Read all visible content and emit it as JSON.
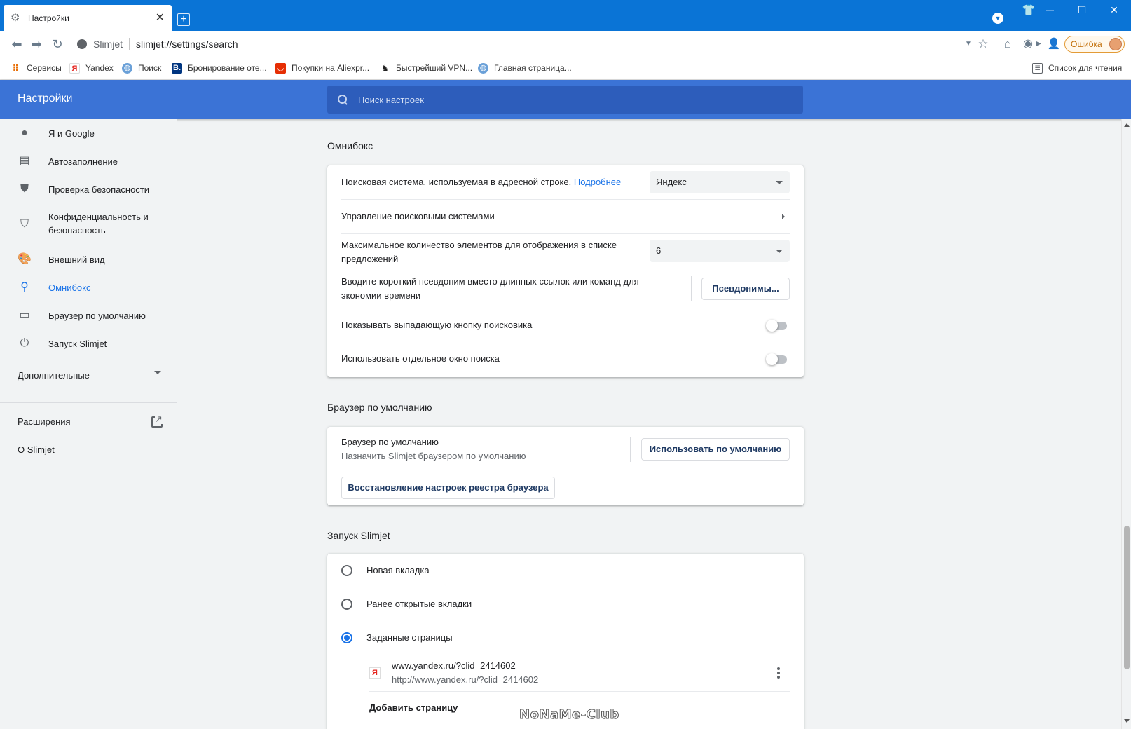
{
  "window": {
    "tab_title": "Настройки",
    "new_tab": "+",
    "controls": {
      "minimize": "—",
      "maximize": "☐",
      "close": "✕"
    }
  },
  "toolbar": {
    "site_name": "Slimjet",
    "url": "slimjet://settings/search",
    "error_label": "Ошибка"
  },
  "bookmarks": [
    {
      "label": "Сервисы",
      "icon": "apps-grid-icon"
    },
    {
      "label": "Yandex",
      "icon": "yandex-icon"
    },
    {
      "label": "Поиск",
      "icon": "globe-icon"
    },
    {
      "label": "Бронирование оте...",
      "icon": "booking-icon"
    },
    {
      "label": "Покупки на Aliexpr...",
      "icon": "aliexpress-icon"
    },
    {
      "label": "Быстрейший VPN...",
      "icon": "vpn-icon"
    },
    {
      "label": "Главная страница...",
      "icon": "globe-icon"
    },
    {
      "label": "Список для чтения",
      "icon": "reading-list-icon"
    }
  ],
  "header": {
    "title": "Настройки",
    "search_placeholder": "Поиск настроек"
  },
  "sidebar": {
    "items": [
      {
        "label": "Я и Google",
        "icon": "person-icon"
      },
      {
        "label": "Автозаполнение",
        "icon": "clipboard-icon"
      },
      {
        "label": "Проверка безопасности",
        "icon": "shield-check-icon"
      },
      {
        "label_line1": "Конфиденциальность и",
        "label_line2": "безопасность",
        "icon": "shield-half-icon"
      },
      {
        "label": "Внешний вид",
        "icon": "palette-icon"
      },
      {
        "label": "Омнибокс",
        "icon": "search-icon",
        "active": true
      },
      {
        "label": "Браузер по умолчанию",
        "icon": "browser-icon"
      },
      {
        "label": "Запуск Slimjet",
        "icon": "power-icon"
      }
    ],
    "advanced": "Дополнительные",
    "extensions": "Расширения",
    "about": "О Slimjet"
  },
  "omnibox": {
    "title": "Омнибокс",
    "search_engine_label": "Поисковая система, используемая в адресной строке.",
    "search_engine_link": "Подробнее",
    "search_engine_value": "Яндекс",
    "manage_engines": "Управление поисковыми системами",
    "max_suggestions_line1": "Максимальное количество элементов для отображения в списке",
    "max_suggestions_line2": "предложений",
    "max_suggestions_value": "6",
    "alias_line1": "Вводите короткий псевдоним вместо длинных ссылок или команд для",
    "alias_line2": "экономии времени",
    "alias_button": "Псевдонимы...",
    "dropdown_button_label": "Показывать выпадающую кнопку поисковика",
    "dropdown_button_on": false,
    "separate_window_label": "Использовать отдельное окно поиска",
    "separate_window_on": false
  },
  "default_browser": {
    "title": "Браузер по умолчанию",
    "label": "Браузер по умолчанию",
    "sublabel": "Назначить Slimjet браузером по умолчанию",
    "make_default_button": "Использовать по умолчанию",
    "restore_button": "Восстановление настроек реестра браузера"
  },
  "startup": {
    "title": "Запуск Slimjet",
    "options": [
      {
        "label": "Новая вкладка",
        "checked": false
      },
      {
        "label": "Ранее открытые вкладки",
        "checked": false
      },
      {
        "label": "Заданные страницы",
        "checked": true
      }
    ],
    "page_title": "www.yandex.ru/?clid=2414602",
    "page_url": "http://www.yandex.ru/?clid=2414602",
    "add_page": "Добавить страницу"
  },
  "watermark": "NoNaMe-Club",
  "colors": {
    "titlebar": "#0a74d6",
    "header": "#3b73d6",
    "accent": "#1a73e8"
  }
}
